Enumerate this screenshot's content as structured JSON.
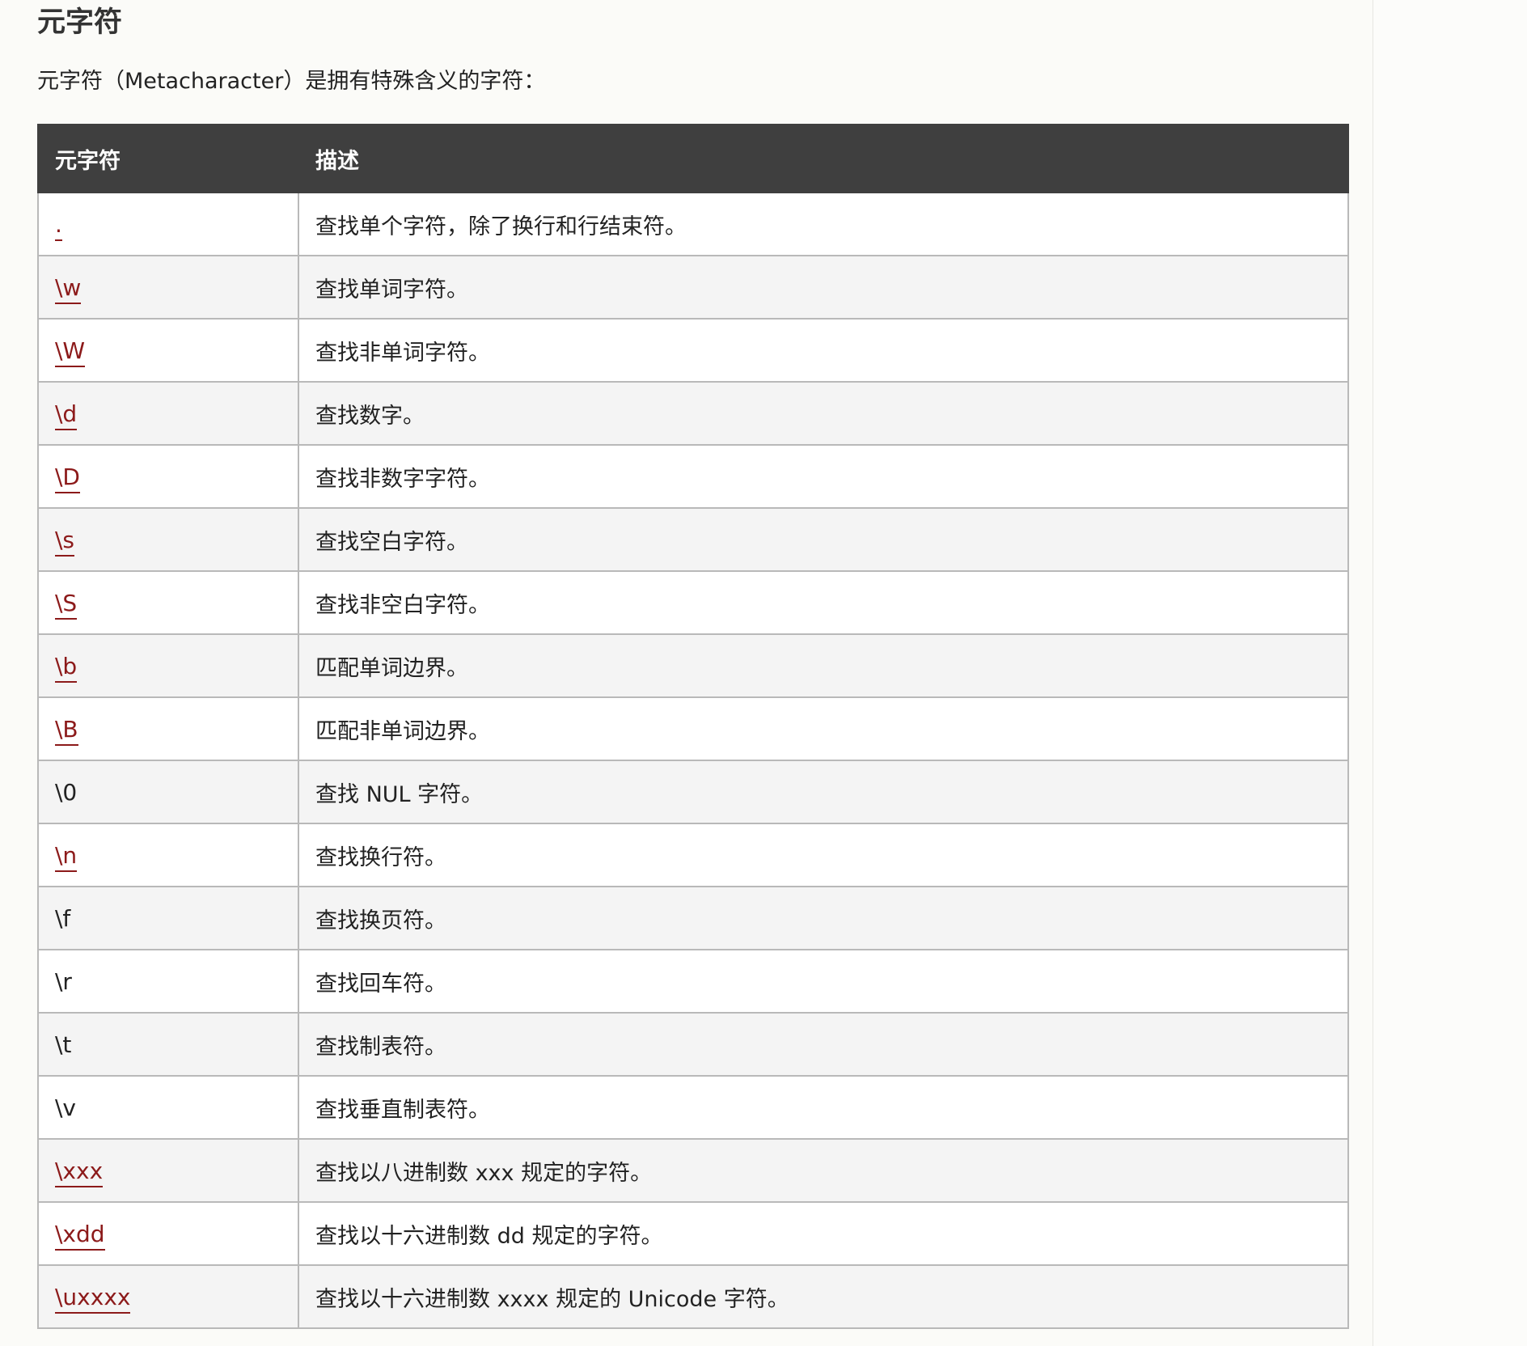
{
  "heading": "元字符",
  "intro": "元字符（Metacharacter）是拥有特殊含义的字符：",
  "table": {
    "headers": [
      "元字符",
      "描述"
    ],
    "rows": [
      {
        "meta": ".",
        "desc": "查找单个字符，除了换行和行结束符。",
        "link": true
      },
      {
        "meta": "\\w",
        "desc": "查找单词字符。",
        "link": true
      },
      {
        "meta": "\\W",
        "desc": "查找非单词字符。",
        "link": true
      },
      {
        "meta": "\\d",
        "desc": "查找数字。",
        "link": true
      },
      {
        "meta": "\\D",
        "desc": "查找非数字字符。",
        "link": true
      },
      {
        "meta": "\\s",
        "desc": "查找空白字符。",
        "link": true
      },
      {
        "meta": "\\S",
        "desc": "查找非空白字符。",
        "link": true
      },
      {
        "meta": "\\b",
        "desc": "匹配单词边界。",
        "link": true
      },
      {
        "meta": "\\B",
        "desc": "匹配非单词边界。",
        "link": true
      },
      {
        "meta": "\\0",
        "desc": "查找 NUL 字符。",
        "link": false
      },
      {
        "meta": "\\n",
        "desc": "查找换行符。",
        "link": true
      },
      {
        "meta": "\\f",
        "desc": "查找换页符。",
        "link": false
      },
      {
        "meta": "\\r",
        "desc": "查找回车符。",
        "link": false
      },
      {
        "meta": "\\t",
        "desc": "查找制表符。",
        "link": false
      },
      {
        "meta": "\\v",
        "desc": "查找垂直制表符。",
        "link": false
      },
      {
        "meta": "\\xxx",
        "desc": "查找以八进制数 xxx 规定的字符。",
        "link": true
      },
      {
        "meta": "\\xdd",
        "desc": "查找以十六进制数 dd 规定的字符。",
        "link": true
      },
      {
        "meta": "\\uxxxx",
        "desc": "查找以十六进制数 xxxx 规定的 Unicode 字符。",
        "link": true
      }
    ]
  },
  "colors": {
    "link": "#8c1a1a",
    "header_bg": "#3f3f3f",
    "row_alt_bg": "#f4f4f4",
    "border": "#b9b9b9"
  }
}
